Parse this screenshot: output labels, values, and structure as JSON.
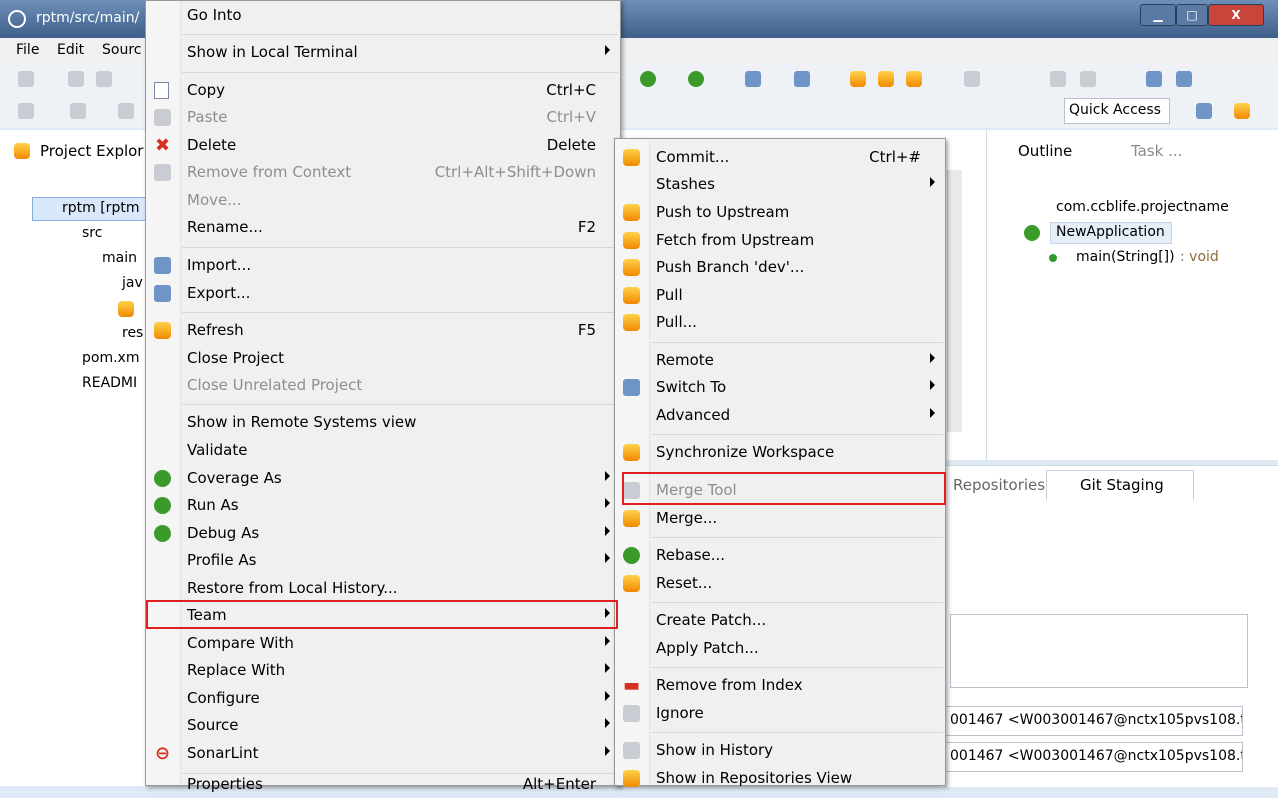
{
  "window": {
    "title": "rptm/src/main/",
    "min": "▁",
    "max": "□",
    "close": "X"
  },
  "menubar": [
    "File",
    "Edit",
    "Sourc"
  ],
  "quick_access": "Quick Access",
  "project_explorer": {
    "tab_label": "Project Explor",
    "tree": [
      "rptm [rptm",
      "src",
      "main",
      "jav",
      "",
      "res",
      "pom.xm",
      "READMI"
    ]
  },
  "outline": {
    "tab_label": "Outline",
    "task_tab": "Task ...",
    "package": "com.ccblife.projectname",
    "class": "NewApplication",
    "method": "main(String[])",
    "method_type": " : void"
  },
  "lower": {
    "repositories_tab": "Repositories",
    "staging_tab": "Git Staging",
    "author": "001467 <W003001467@nctx105pvs108.t",
    "committer": "001467 <W003001467@nctx105pvs108.t"
  },
  "context_menu": [
    {
      "label": "Go Into"
    },
    {
      "label": "Show in Local Terminal",
      "submenu": true
    },
    {
      "label": "Copy",
      "shortcut": "Ctrl+C"
    },
    {
      "label": "Paste",
      "shortcut": "Ctrl+V",
      "disabled": true
    },
    {
      "label": "Delete",
      "shortcut": "Delete"
    },
    {
      "label": "Remove from Context",
      "shortcut": "Ctrl+Alt+Shift+Down",
      "disabled": true
    },
    {
      "label": "Move...",
      "disabled": true
    },
    {
      "label": "Rename...",
      "shortcut": "F2"
    },
    {
      "label": "Import..."
    },
    {
      "label": "Export..."
    },
    {
      "label": "Refresh",
      "shortcut": "F5"
    },
    {
      "label": "Close Project"
    },
    {
      "label": "Close Unrelated Project",
      "disabled": true
    },
    {
      "label": "Show in Remote Systems view"
    },
    {
      "label": "Validate"
    },
    {
      "label": "Coverage As",
      "submenu": true
    },
    {
      "label": "Run As",
      "submenu": true
    },
    {
      "label": "Debug As",
      "submenu": true
    },
    {
      "label": "Profile As",
      "submenu": true
    },
    {
      "label": "Restore from Local History..."
    },
    {
      "label": "Team",
      "submenu": true
    },
    {
      "label": "Compare With",
      "submenu": true
    },
    {
      "label": "Replace With",
      "submenu": true
    },
    {
      "label": "Configure",
      "submenu": true
    },
    {
      "label": "Source",
      "submenu": true
    },
    {
      "label": "SonarLint",
      "submenu": true
    },
    {
      "label": "Properties",
      "shortcut": "Alt+Enter"
    }
  ],
  "team_submenu": [
    {
      "label": "Commit...",
      "shortcut": "Ctrl+#"
    },
    {
      "label": "Stashes",
      "submenu": true
    },
    {
      "label": "Push to Upstream"
    },
    {
      "label": "Fetch from Upstream"
    },
    {
      "label": "Push Branch 'dev'..."
    },
    {
      "label": "Pull"
    },
    {
      "label": "Pull..."
    },
    {
      "label": "Remote",
      "submenu": true
    },
    {
      "label": "Switch To",
      "submenu": true
    },
    {
      "label": "Advanced",
      "submenu": true
    },
    {
      "label": "Synchronize Workspace"
    },
    {
      "label": "Merge Tool",
      "disabled": true
    },
    {
      "label": "Merge..."
    },
    {
      "label": "Rebase..."
    },
    {
      "label": "Reset..."
    },
    {
      "label": "Create Patch..."
    },
    {
      "label": "Apply Patch..."
    },
    {
      "label": "Remove from Index"
    },
    {
      "label": "Ignore"
    },
    {
      "label": "Show in History"
    },
    {
      "label": "Show in Repositories View"
    }
  ],
  "colors": {
    "highlight": "#e02020",
    "title_bar": "#4a6c97",
    "menu_bg": "#f0f0f0"
  }
}
